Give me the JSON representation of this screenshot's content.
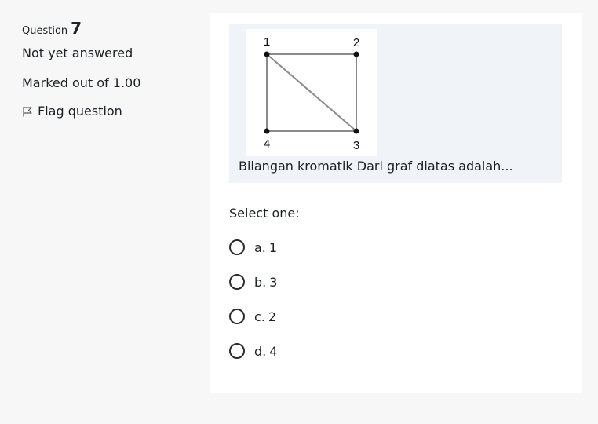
{
  "info": {
    "question_label": "Question",
    "question_number": "7",
    "state": "Not yet answered",
    "grade": "Marked out of 1.00",
    "flag_label": "Flag question"
  },
  "question": {
    "text": "Bilangan kromatik Dari graf diatas adalah...",
    "graph_vertex_labels": [
      "1",
      "2",
      "3",
      "4"
    ]
  },
  "prompt": "Select one:",
  "answers": [
    {
      "number": "a.",
      "text": "1"
    },
    {
      "number": "b.",
      "text": "3"
    },
    {
      "number": "c.",
      "text": "2"
    },
    {
      "number": "d.",
      "text": "4"
    }
  ]
}
